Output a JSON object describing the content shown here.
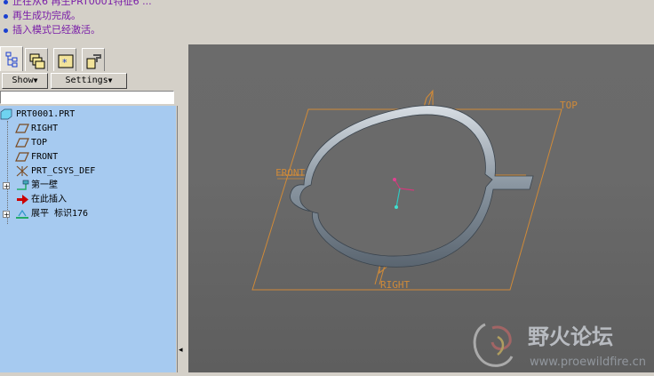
{
  "messages": [
    "正在从6 再生PRT0001特征6 ...",
    "再生成功完成。",
    "插入模式已经激活。"
  ],
  "tabs": [
    {
      "icon": "model-tree-icon"
    },
    {
      "icon": "layers-icon"
    },
    {
      "icon": "favorites-icon"
    },
    {
      "icon": "connections-icon"
    }
  ],
  "buttons": {
    "show": "Show",
    "settings": "Settings"
  },
  "tree": {
    "root": "PRT0001.PRT",
    "items": [
      {
        "label": "RIGHT",
        "icon": "datum-plane-icon"
      },
      {
        "label": "TOP",
        "icon": "datum-plane-icon"
      },
      {
        "label": "FRONT",
        "icon": "datum-plane-icon"
      },
      {
        "label": "PRT_CSYS_DEF",
        "icon": "csys-icon"
      },
      {
        "label": "第一壁",
        "icon": "wall-feature-icon"
      },
      {
        "label": "在此插入",
        "icon": "insert-arrow-icon"
      },
      {
        "label": "展平 标识176",
        "icon": "flatten-feature-icon"
      }
    ]
  },
  "viewport": {
    "datum_labels": {
      "top": "TOP",
      "front": "FRONT",
      "right": "RIGHT"
    }
  },
  "watermark": {
    "title": "野火论坛",
    "url": "www.proewildfire.cn"
  }
}
